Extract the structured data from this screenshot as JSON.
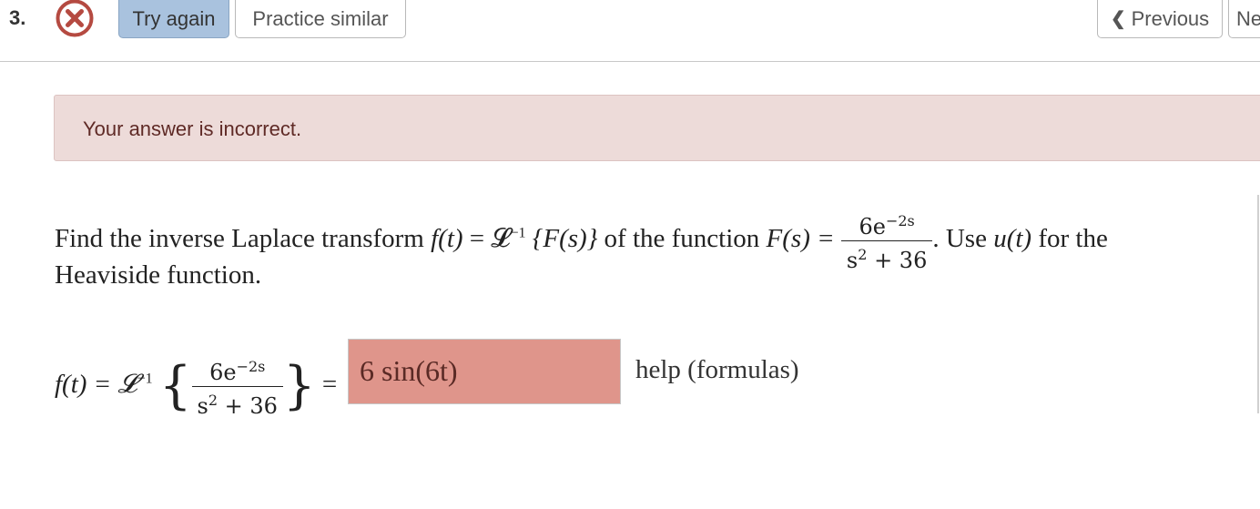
{
  "header": {
    "question_number": "3.",
    "status_icon": "x-circle-icon",
    "status_color": "#b54a41",
    "buttons": {
      "try_again": "Try again",
      "practice_similar": "Practice similar",
      "previous": "Previous",
      "next": "Ne"
    }
  },
  "alert": {
    "message": "Your answer is incorrect.",
    "background": "#eddbd9"
  },
  "problem": {
    "line1_intro": "Find the inverse Laplace transform",
    "line1_of_function": "of the function",
    "line1_use": ". Use",
    "line1_for_the": "for the",
    "line2": "Heaviside function.",
    "f_of_t": "f(t)",
    "laplace_inv": "= 𝓛",
    "laplace_inv_sup": "−1",
    "F_of_s_braced": "{F(s)}",
    "F_of_s": "F(s) =",
    "u_of_t": "u(t)",
    "numerator_coef": "6e",
    "numerator_exp": "−2s",
    "denominator_base": "s",
    "denominator_exp": "2",
    "denominator_rest": " + 36"
  },
  "answer": {
    "lhs_f": "f(t) = 𝓛",
    "lhs_sup": "−1",
    "equals": "=",
    "value": "6 sin(6t)",
    "box_color": "#df958b",
    "help_link": "help (formulas)"
  }
}
